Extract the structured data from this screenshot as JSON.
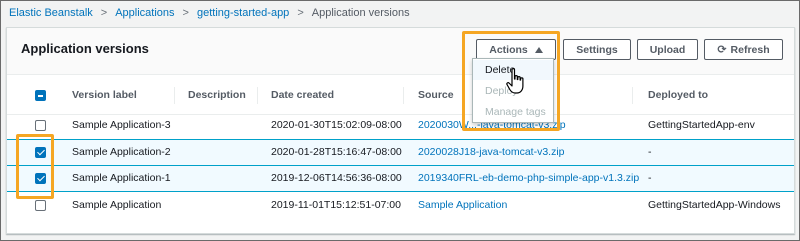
{
  "breadcrumb": {
    "items": [
      "Elastic Beanstalk",
      "Applications",
      "getting-started-app"
    ],
    "current": "Application versions",
    "separator": ">"
  },
  "panel": {
    "title": "Application versions",
    "buttons": {
      "actions": "Actions",
      "settings": "Settings",
      "upload": "Upload",
      "refresh": "Refresh"
    }
  },
  "table": {
    "headers": {
      "version_label": "Version label",
      "description": "Description",
      "date_created": "Date created",
      "source": "Source",
      "deployed_to": "Deployed to"
    },
    "rows": [
      {
        "label": "Sample Application-3",
        "description": "",
        "date": "2020-01-30T15:02:09-08:00",
        "source": "2020030W...-java-tomcat-v3.zip",
        "deployed": "GettingStartedApp-env",
        "checked": false,
        "selected": false
      },
      {
        "label": "Sample Application-2",
        "description": "",
        "date": "2020-01-28T15:16:47-08:00",
        "source": "2020028J18-java-tomcat-v3.zip",
        "deployed": "-",
        "checked": true,
        "selected": true
      },
      {
        "label": "Sample Application-1",
        "description": "",
        "date": "2019-12-06T14:56:36-08:00",
        "source": "2019340FRL-eb-demo-php-simple-app-v1.3.zip",
        "deployed": "-",
        "checked": true,
        "selected": true
      },
      {
        "label": "Sample Application",
        "description": "",
        "date": "2019-11-01T15:12:51-07:00",
        "source": "Sample Application",
        "deployed": "GettingStartedApp-Windows",
        "checked": false,
        "selected": false
      }
    ]
  },
  "actions_menu": {
    "items": [
      {
        "label": "Delete",
        "state": "active"
      },
      {
        "label": "Deploy",
        "state": "disabled"
      },
      {
        "label": "Manage tags",
        "state": "disabled"
      }
    ]
  },
  "colors": {
    "link": "#0073bb",
    "highlight": "#f5a623",
    "selected_row": "#f1faff",
    "selected_border": "#00a1c9"
  }
}
